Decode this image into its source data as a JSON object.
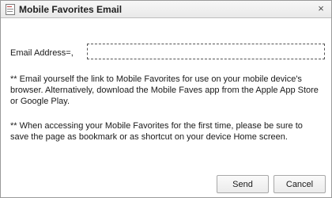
{
  "dialog": {
    "title": "Mobile Favorites Email",
    "close_glyph": "×"
  },
  "form": {
    "email_label": "Email Address=,",
    "email_value": "",
    "email_placeholder": ""
  },
  "notes": [
    "** Email yourself the link to Mobile Favorites for use on your mobile device's browser. Alternatively, download the Mobile Faves app from the Apple App Store or Google Play.",
    "** When accessing your Mobile Favorites for the first time, please be sure to save the page as bookmark or as shortcut on your device Home screen."
  ],
  "buttons": {
    "send_label": "Send",
    "cancel_label": "Cancel"
  },
  "icons": {
    "title": "dialog-app-icon",
    "close": "close-icon"
  }
}
